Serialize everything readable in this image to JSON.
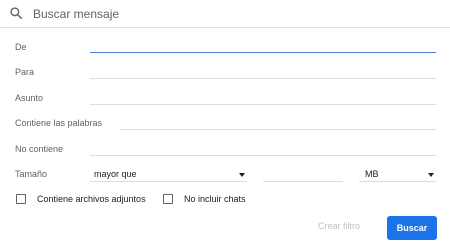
{
  "search": {
    "icon": "search-icon",
    "placeholder": "Buscar mensaje",
    "value": ""
  },
  "fields": {
    "from_label": "De",
    "to_label": "Para",
    "subject_label": "Asunto",
    "has_words_label": "Contiene las palabras",
    "doesnt_have_label": "No contiene",
    "size_label": "Tamaño"
  },
  "size": {
    "operator": "mayor que",
    "value": "",
    "unit": "MB"
  },
  "checkboxes": {
    "has_attachment_label": "Contiene archivos adjuntos",
    "has_attachment_checked": false,
    "exclude_chats_label": "No incluir chats",
    "exclude_chats_checked": false
  },
  "actions": {
    "create_filter_label": "Crear filtro",
    "search_label": "Buscar"
  },
  "colors": {
    "accent": "#1a73e8",
    "focused_underline": "#4a7fd1",
    "disabled_text": "#bdc1c6"
  }
}
